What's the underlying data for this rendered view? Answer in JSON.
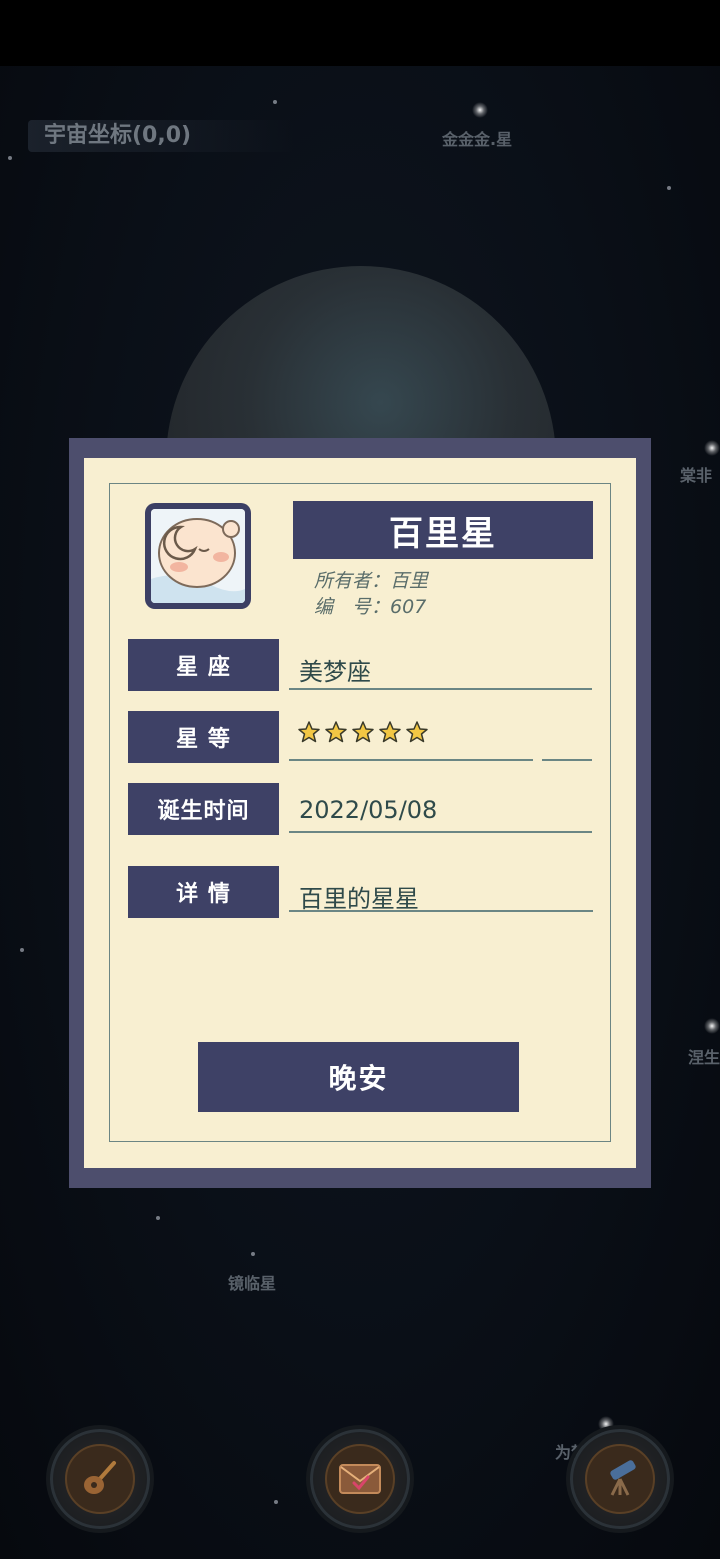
{
  "background": {
    "coordinates": "宇宙坐标(0,0)",
    "star_labels": {
      "top": "金金金.星",
      "right_upper": "棠非",
      "right_lower": "涅生",
      "lower_left": "镜临星",
      "bottom_right": "为梦"
    }
  },
  "modal": {
    "star_name": "百里星",
    "owner_label": "所有者：",
    "owner": "百里",
    "id_label": "编　号：",
    "id_value": "607",
    "rows": [
      {
        "label": "星 座",
        "value": "美梦座"
      },
      {
        "label": "星 等",
        "rating": 5,
        "rating_max": 5
      },
      {
        "label": "诞生时间",
        "value": "2022/05/08"
      },
      {
        "label": "详 情",
        "value": "百里的星星"
      }
    ],
    "button": "晚安"
  },
  "dock": {
    "icons": [
      "guitar-icon",
      "mail-heart-icon",
      "telescope-icon"
    ]
  },
  "colors": {
    "panel": "#3e4166",
    "paper": "#f8efd1",
    "star": "#f2c744"
  }
}
